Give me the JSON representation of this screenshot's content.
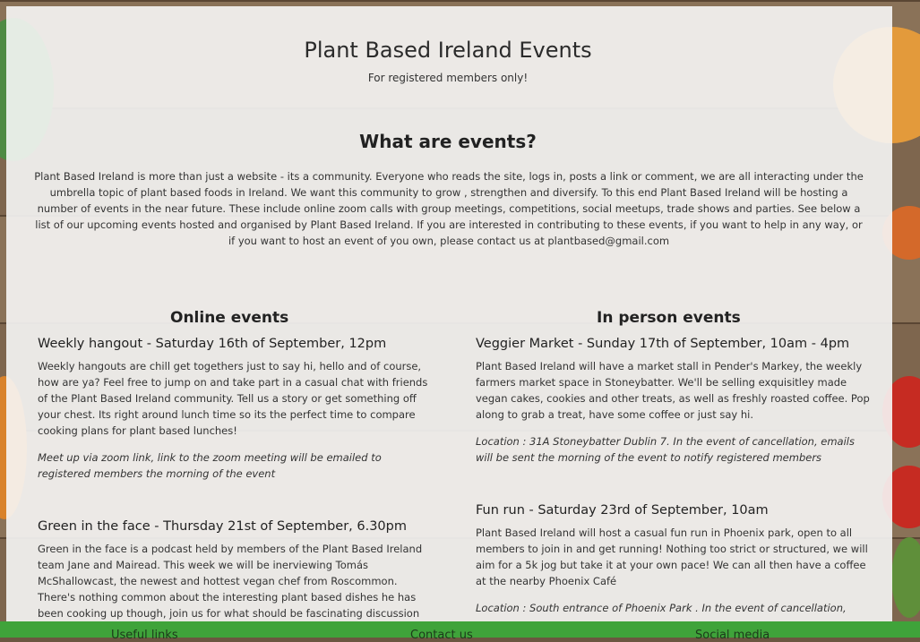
{
  "header": {
    "title": "Plant Based Ireland Events",
    "subtitle": "For registered members only!"
  },
  "intro": {
    "heading": "What are events?",
    "text": "Plant Based Ireland is more than just a website - its a community. Everyone who reads the site, logs in, posts a link or comment, we are all interacting under the umbrella topic of plant based foods in Ireland. We want this community to grow , strengthen and diversify. To this end Plant Based Ireland will be hosting a number of events in the near future. These include online zoom calls with group meetings, competitions, social meetups, trade shows and parties. See below a list of our upcoming events hosted and organised by Plant Based Ireland. If you are interested in contributing to these events, if you want to help in any way, or if you want to host an event of you own, please contact us at plantbased@gmail.com"
  },
  "online": {
    "heading": "Online events",
    "events": [
      {
        "title": "Weekly hangout - Saturday 16th of September, 12pm",
        "description": "Weekly hangouts are chill get togethers just to say hi, hello and of course, how are ya? Feel free to jump on and take part in a casual chat with friends of the Plant Based Ireland community. Tell us a story or get something off your chest. Its right around lunch time so its the perfect time to compare cooking plans for plant based lunches!",
        "note": "Meet up via zoom link, link to the zoom meeting will be emailed to registered members the morning of the event"
      },
      {
        "title": "Green in the face - Thursday 21st of September, 6.30pm",
        "description": "Green in the face is a podcast held by members of the Plant Based Ireland team Jane and Mairead. This week we will be inerviewing Tomás McShallowcast, the newest and hottest vegan chef from Roscommon. There's nothing common about the interesting plant based dishes he has been cooking up though, join us for what should be fascinating discussion on"
      }
    ]
  },
  "inperson": {
    "heading": "In person events",
    "events": [
      {
        "title": "Veggier Market - Sunday 17th of September, 10am - 4pm",
        "description": "Plant Based Ireland will have a market stall in Pender's Markey, the weekly farmers market space in Stoneybatter. We'll be selling exquisitley made vegan cakes, cookies and other treats, as well as freshly roasted coffee. Pop along to grab a treat, have some coffee or just say hi.",
        "note": "Location : 31A Stoneybatter Dublin 7. In the event of cancellation, emails will be sent the morning of the event to notify registered members"
      },
      {
        "title": "Fun run - Saturday 23rd of September, 10am",
        "description": "Plant Based Ireland will host a casual fun run in Phoenix park, open to all members to join in and get running! Nothing too strict or structured, we will aim for a 5k jog but take it at your own pace! We can all then have a coffee at the nearby Phoenix Café",
        "note": "Location : South entrance of Phoenix Park . In the event of cancellation,"
      }
    ]
  },
  "footer": {
    "col1": "Useful links",
    "col2": "Contact us",
    "col3": "Social media"
  },
  "colors": {
    "footer": "#3fa33a",
    "panel": "#f6f6f6"
  }
}
